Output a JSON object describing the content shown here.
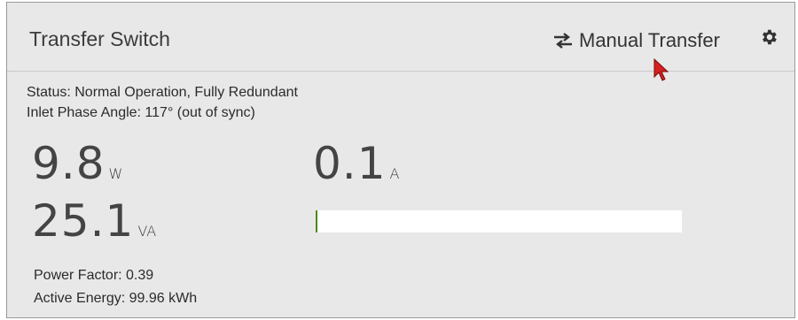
{
  "header": {
    "title": "Transfer Switch",
    "manual_transfer_label": "Manual Transfer",
    "transfer_icon": "swap-arrows-icon",
    "settings_icon": "gear-icon"
  },
  "status": {
    "status_line": "Status: Normal Operation, Fully Redundant",
    "phase_line": "Inlet Phase Angle: 117° (out of sync)"
  },
  "metrics": {
    "active_power": {
      "value": "9.8",
      "unit": "W"
    },
    "apparent_power": {
      "value": "25.1",
      "unit": "VA"
    },
    "current": {
      "value": "0.1",
      "unit": "A"
    }
  },
  "current_bar": {
    "level_fraction": 0.005,
    "fill_color": "#4a8a18"
  },
  "footer": {
    "power_factor": "Power Factor: 0.39",
    "active_energy": "Active Energy: 99.96 kWh"
  },
  "colors": {
    "panel_bg": "#e8e8e8",
    "accent_cursor": "#d62020"
  }
}
